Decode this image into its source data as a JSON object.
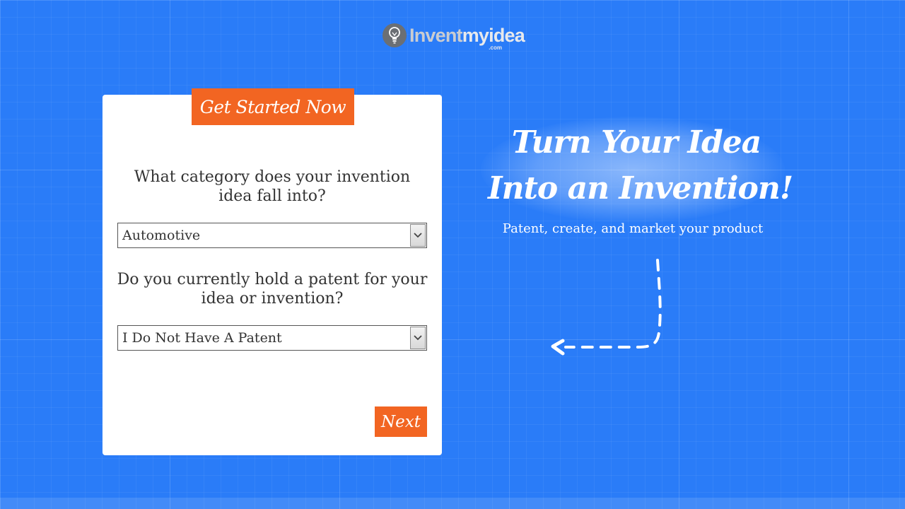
{
  "logo": {
    "word1": "Invent",
    "word2": "myidea",
    "tld": ".com"
  },
  "card": {
    "tab_label": "Get Started Now",
    "question1": "What category does your invention idea fall into?",
    "select1_value": "Automotive",
    "question2": "Do you currently hold a patent for your idea or invention?",
    "select2_value": "I Do Not Have A Patent",
    "next_label": "Next"
  },
  "hero": {
    "headline_line1": "Turn Your Idea",
    "headline_line2": "Into an Invention!",
    "subheadline": "Patent, create, and market your product"
  },
  "icons": [
    "lightbulb-icon",
    "chevron-down-icon",
    "dashed-arrow-icon"
  ],
  "colors": {
    "background": "#2a7cf8",
    "accent": "#f26522",
    "card": "#ffffff"
  }
}
